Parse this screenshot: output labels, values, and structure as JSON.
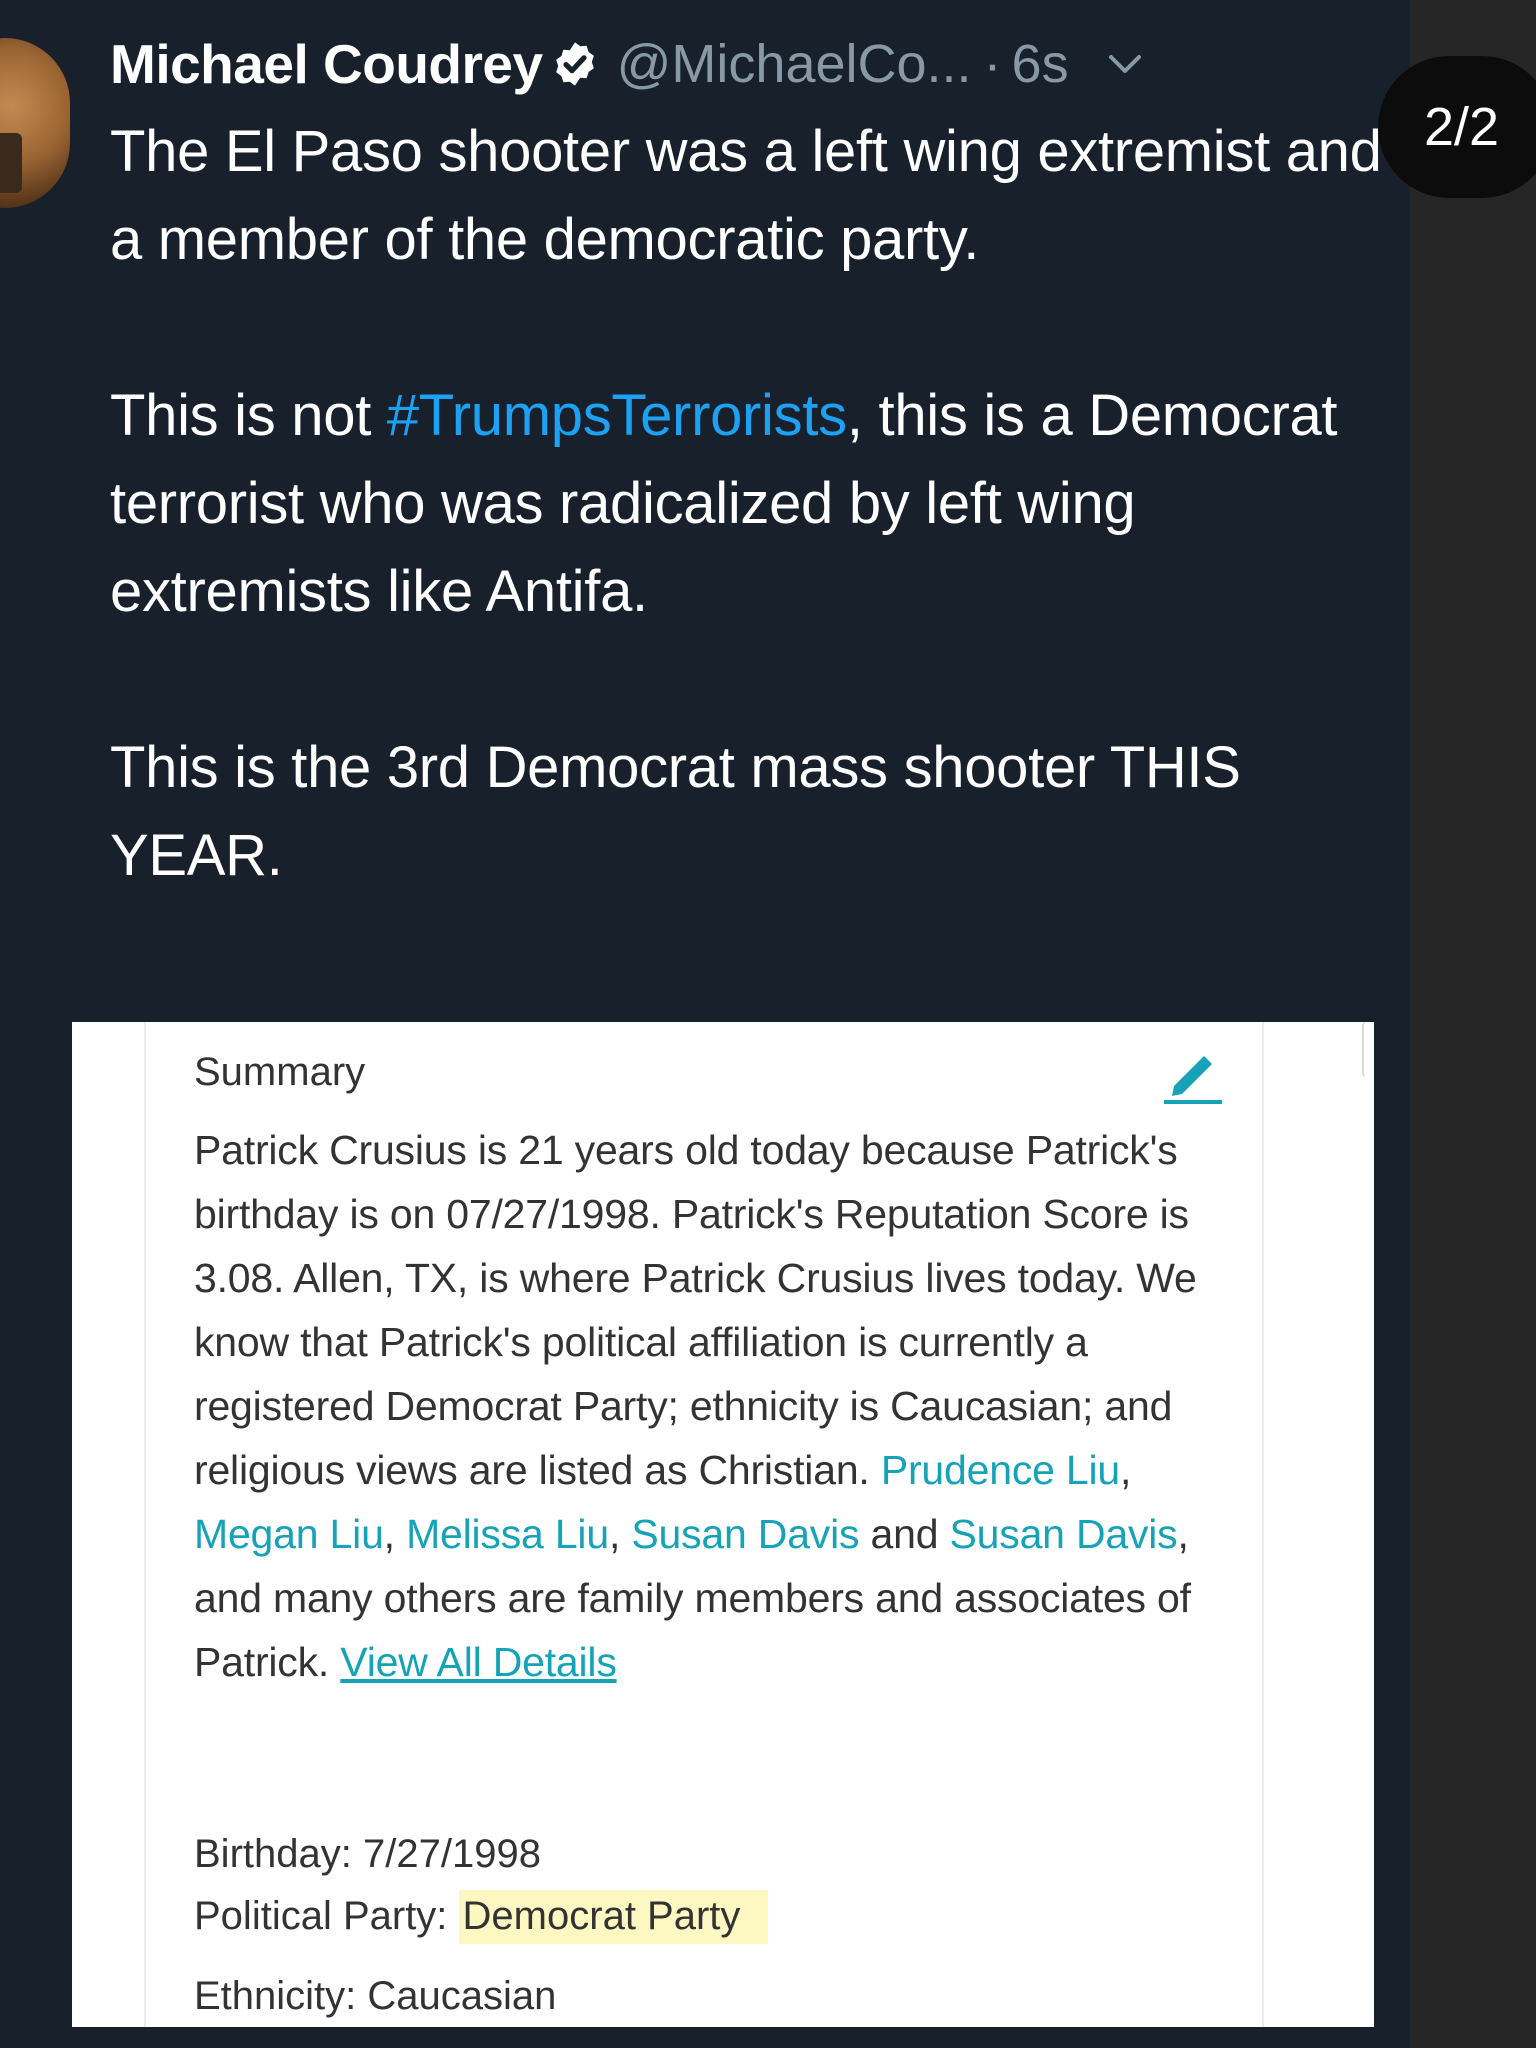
{
  "page_counter": "2/2",
  "tweet": {
    "display_name": "Michael Coudrey",
    "handle": "@MichaelCo...",
    "separator": "·",
    "time": "6s",
    "paragraph1": "The El Paso shooter was a left wing extremist and a member of the democratic party.",
    "paragraph2_before": "This is not ",
    "paragraph2_hashtag": "#TrumpsTerrorists",
    "paragraph2_after": ", this is a Democrat terrorist who was radicalized by left wing extremists like Antifa.",
    "paragraph3": "This is the 3rd Democrat mass shooter THIS YEAR.",
    "hashtag_color": "#1da1f2",
    "verified_icon": "verified-badge-icon",
    "more_icon": "chevron-down-icon"
  },
  "card": {
    "summary_title": "Summary",
    "edit_icon": "pencil-icon",
    "summary_text_1": "Patrick Crusius is 21 years old today because Patrick's birthday is on 07/27/1998. Patrick's Reputation Score is 3.08. Allen, TX, is where Patrick Crusius lives today. We know that Patrick's political affiliation is currently a registered Democrat Party; ethnicity is Caucasian; and religious views are listed as Christian. ",
    "relatives": [
      "Prudence Liu",
      "Megan Liu",
      "Melissa Liu",
      "Susan Davis",
      "Susan Davis"
    ],
    "sep_comma": ", ",
    "sep_and": " and ",
    "summary_text_2": ", and many others are family members and associates of Patrick. ",
    "view_all": "View All Details",
    "link_color": "#16a3b8",
    "birthday_label": "Birthday:",
    "birthday_value": "7/27/1998",
    "party_label": "Political Party:",
    "party_value": "Democrat Party",
    "highlight_color": "#fdf7c2",
    "ethnicity_label": "Ethnicity:",
    "ethnicity_value": "Caucasian"
  }
}
